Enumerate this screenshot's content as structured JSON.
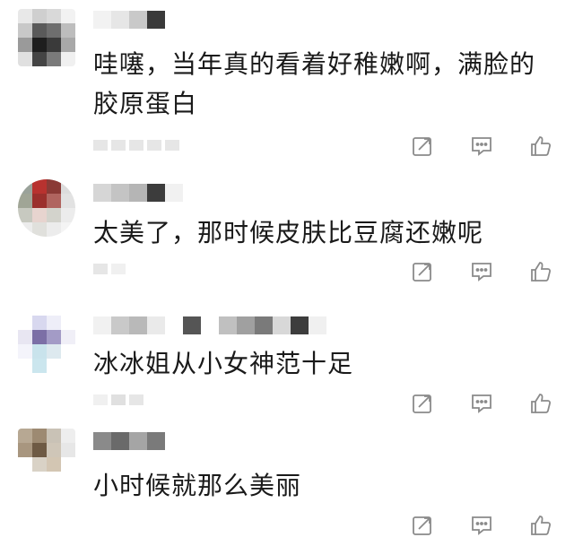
{
  "comments": [
    {
      "text": "哇噻，当年真的看着好稚嫩啊，满脸的胶原蛋白",
      "icons": [
        "share-icon",
        "comment-icon",
        "like-icon"
      ]
    },
    {
      "text": "太美了，那时候皮肤比豆腐还嫩呢",
      "icons": [
        "share-icon",
        "comment-icon",
        "like-icon"
      ]
    },
    {
      "text": "冰冰姐从小女神范十足",
      "icons": [
        "share-icon",
        "comment-icon",
        "like-icon"
      ]
    },
    {
      "text": "小时候就那么美丽",
      "icons": [
        "share-icon",
        "comment-icon",
        "like-icon"
      ]
    }
  ],
  "colors": {
    "icon": "#8a8a8a",
    "text": "#1a1a1a"
  }
}
